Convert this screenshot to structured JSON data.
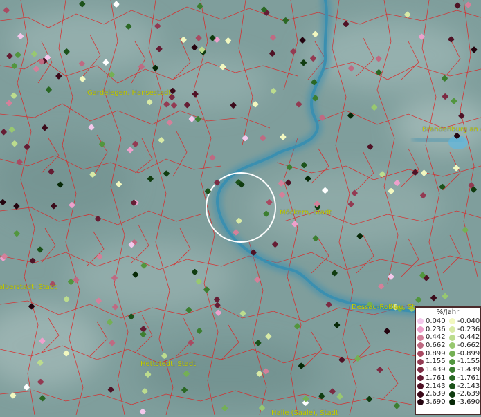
{
  "map": {
    "places": [
      {
        "name": "Gardelegen, Hansestadt"
      },
      {
        "name": "Brandenburg an d"
      },
      {
        "name": "Möckern, Stadt"
      },
      {
        "name": "Dessau-Roßlau, St"
      },
      {
        "name": "alberstadt, Stadt"
      },
      {
        "name": "Hettstedt, Stadt"
      },
      {
        "name": "Halle (Saale), Stadt"
      }
    ],
    "legend": {
      "title": "%/Jahr",
      "positive": [
        {
          "label": "0.040",
          "color": "#f4c8ec"
        },
        {
          "label": "0.236",
          "color": "#eea0cc"
        },
        {
          "label": "0.442",
          "color": "#d4809a"
        },
        {
          "label": "0.662",
          "color": "#bf6a82"
        },
        {
          "label": "0.899",
          "color": "#a94a62"
        },
        {
          "label": "1.155",
          "color": "#933a52"
        },
        {
          "label": "1.439",
          "color": "#7c2a42"
        },
        {
          "label": "1.761",
          "color": "#651c33"
        },
        {
          "label": "2.143",
          "color": "#4f1225"
        },
        {
          "label": "2.639",
          "color": "#3b0a1a"
        },
        {
          "label": "3.690",
          "color": "#24040f"
        }
      ],
      "negative": [
        {
          "label": "-0.040",
          "color": "#f2f8c0"
        },
        {
          "label": "-0.236",
          "color": "#d8eaa6"
        },
        {
          "label": "-0.442",
          "color": "#bcdc8e"
        },
        {
          "label": "-0.662",
          "color": "#98c870"
        },
        {
          "label": "-0.899",
          "color": "#74b054"
        },
        {
          "label": "-1.155",
          "color": "#52963e"
        },
        {
          "label": "-1.439",
          "color": "#3c7e30"
        },
        {
          "label": "-1.761",
          "color": "#2a6824"
        },
        {
          "label": "-2.143",
          "color": "#1c521a"
        },
        {
          "label": "-2.639",
          "color": "#103c10"
        },
        {
          "label": "-3.690",
          "color": "#062806"
        }
      ]
    },
    "colors": {
      "background": "#7f9e9c",
      "boundaries": "#e02020",
      "river": "#3a8fb0",
      "label": "#c8d000",
      "search_circle": "#ffffff"
    }
  }
}
